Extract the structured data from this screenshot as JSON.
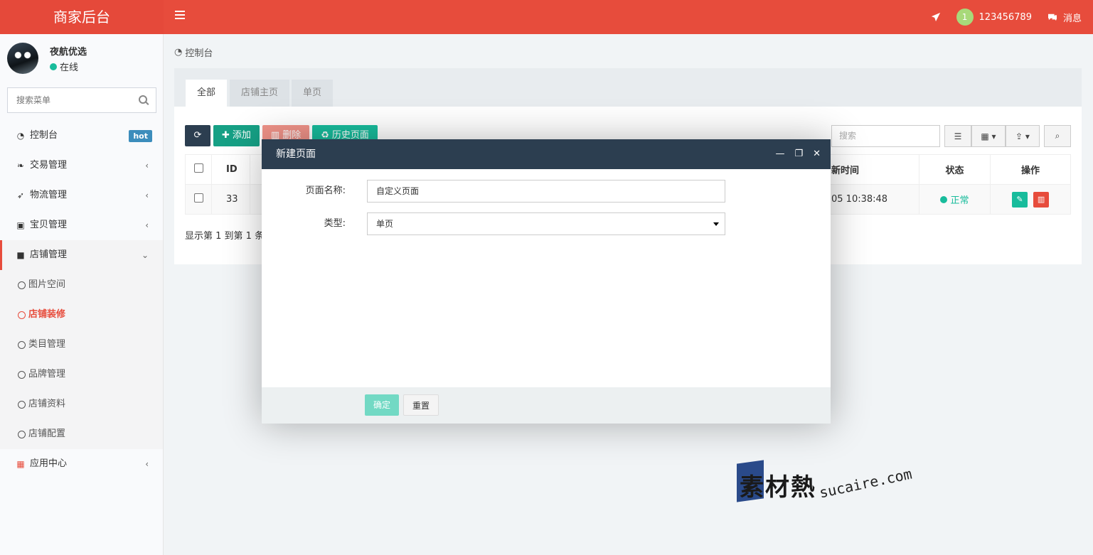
{
  "header": {
    "brand": "商家后台",
    "user_badge": "1",
    "user_id": "123456789",
    "messages_label": "消息"
  },
  "sidebar": {
    "user_name": "夜航优选",
    "user_status": "在线",
    "search_placeholder": "搜索菜单",
    "items": [
      {
        "label": "控制台",
        "icon": "dashboard-icon",
        "badge": "hot"
      },
      {
        "label": "交易管理",
        "icon": "leaf-icon"
      },
      {
        "label": "物流管理",
        "icon": "rocket-icon"
      },
      {
        "label": "宝贝管理",
        "icon": "shopping-bag-icon"
      },
      {
        "label": "店铺管理",
        "icon": "archive-icon",
        "expanded": true
      },
      {
        "label": "应用中心",
        "icon": "grid-icon"
      }
    ],
    "sub_items": [
      "图片空间",
      "店铺装修",
      "类目管理",
      "品牌管理",
      "店铺资料",
      "店铺配置"
    ],
    "current_sub": "店铺装修"
  },
  "breadcrumb": "控制台",
  "tabs": [
    "全部",
    "店铺主页",
    "单页"
  ],
  "toolbar": {
    "add": "添加",
    "delete": "删除",
    "history": "历史页面",
    "search_placeholder": "搜索"
  },
  "table": {
    "headers": {
      "id": "ID",
      "time": "新时间",
      "status": "状态",
      "ops": "操作"
    },
    "rows": [
      {
        "id": "33",
        "time": "05 10:38:48",
        "status": "正常"
      }
    ],
    "pager": "显示第 1 到第 1 条"
  },
  "modal": {
    "title": "新建页面",
    "name_label": "页面名称:",
    "name_value": "自定义页面",
    "type_label": "类型:",
    "type_value": "单页",
    "ok": "确定",
    "reset": "重置"
  },
  "watermark": {
    "zh": "素材熱",
    "en": "sucaire.com"
  },
  "colors": {
    "primary_red": "#e74c3c",
    "dark": "#2c3e50",
    "teal": "#18bc9c"
  }
}
